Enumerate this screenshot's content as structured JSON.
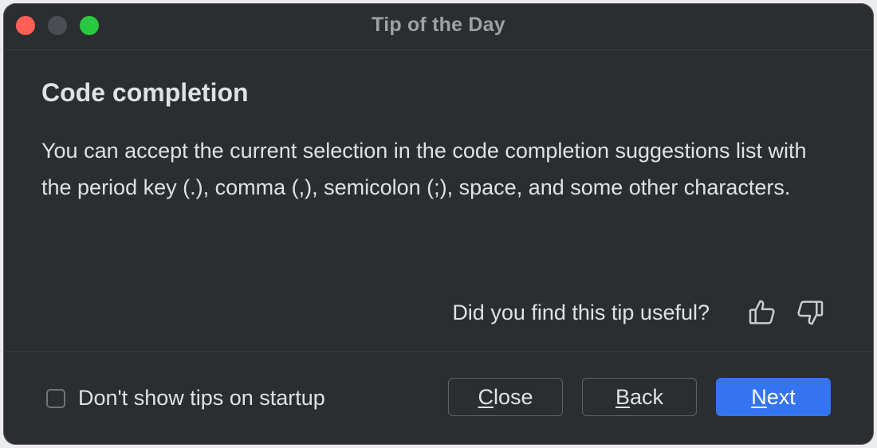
{
  "window": {
    "title": "Tip of the Day"
  },
  "tip": {
    "heading": "Code completion",
    "text": "You can accept the current selection in the code completion suggestions list with the period key (.), comma (,), semicolon (;), space, and some other characters."
  },
  "feedback": {
    "question": "Did you find this tip useful?",
    "icons": [
      "thumbs-up-icon",
      "thumbs-down-icon"
    ]
  },
  "footer": {
    "checkbox_label": "Don't show tips on startup",
    "checkbox_checked": false,
    "close": {
      "mnemonic": "C",
      "rest": "lose"
    },
    "back": {
      "mnemonic": "B",
      "rest": "ack"
    },
    "next": {
      "mnemonic": "N",
      "rest": "ext"
    }
  },
  "colors": {
    "background": "#2b2d31",
    "text": "#dfe1e5",
    "primary_button": "#3574f0",
    "traffic_close": "#ff5f57",
    "traffic_max": "#28c840"
  }
}
